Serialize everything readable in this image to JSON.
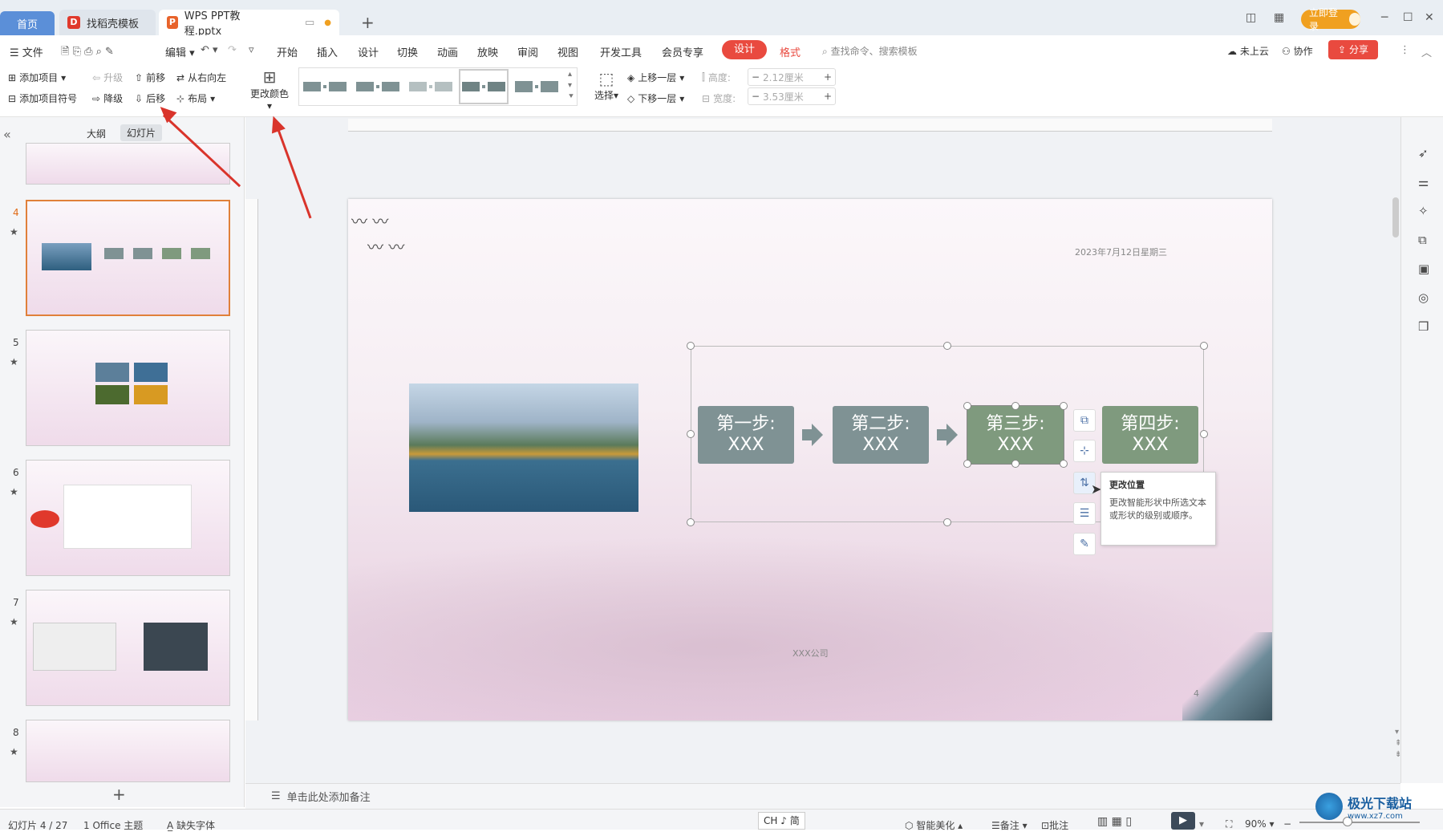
{
  "tabs": {
    "home": "首页",
    "template": "找稻壳模板",
    "doc": "WPS PPT教程.pptx",
    "login": "立即登录"
  },
  "menu": {
    "file": "文件",
    "edit": "编辑",
    "items": [
      "开始",
      "插入",
      "设计",
      "切换",
      "动画",
      "放映",
      "审阅",
      "视图",
      "开发工具",
      "会员专享"
    ],
    "active_tab": "设计",
    "format_tab": "格式",
    "search_placeholder": "查找命令、搜索模板",
    "cloud": "未上云",
    "collab": "协作",
    "share": "分享"
  },
  "ribbon": {
    "add_item": "添加项目",
    "add_bullet": "添加项目符号",
    "promote": "升级",
    "demote": "降级",
    "move_up": "前移",
    "move_down": "后移",
    "right_to_left": "从右向左",
    "layout": "布局",
    "change_color": "更改颜色",
    "select": "选择",
    "bring_forward": "上移一层",
    "send_backward": "下移一层",
    "height_label": "高度:",
    "height_value": "2.12厘米",
    "width_label": "宽度:",
    "width_value": "3.53厘米"
  },
  "left_panel": {
    "outline_tab": "大纲",
    "slides_tab": "幻灯片",
    "slide_numbers": [
      "4",
      "5",
      "6",
      "7",
      "8"
    ]
  },
  "slide": {
    "date": "2023年7月12日星期三",
    "steps": [
      "第一步:",
      "第二步:",
      "第三步:",
      "第四步:"
    ],
    "step_sub": "XXX",
    "footer": "XXX公司",
    "page_num": "4"
  },
  "tooltip": {
    "title": "更改位置",
    "body": "更改智能形状中所选文本或形状的级别或顺序。"
  },
  "notes_placeholder": "单击此处添加备注",
  "status": {
    "slide_info": "幻灯片 4 / 27",
    "theme": "1 Office 主题",
    "missing_font": "缺失字体",
    "ime": "CH ♪ 简",
    "beautify": "智能美化",
    "notes": "备注",
    "comments": "批注",
    "zoom": "90%"
  },
  "watermark": "极光下载站",
  "watermark_url": "www.xz7.com",
  "colors": {
    "step_gray": "#7f9294",
    "step_green": "#7f9a7e",
    "accent_red": "#e94a3f",
    "home_blue": "#5b8fd8"
  }
}
